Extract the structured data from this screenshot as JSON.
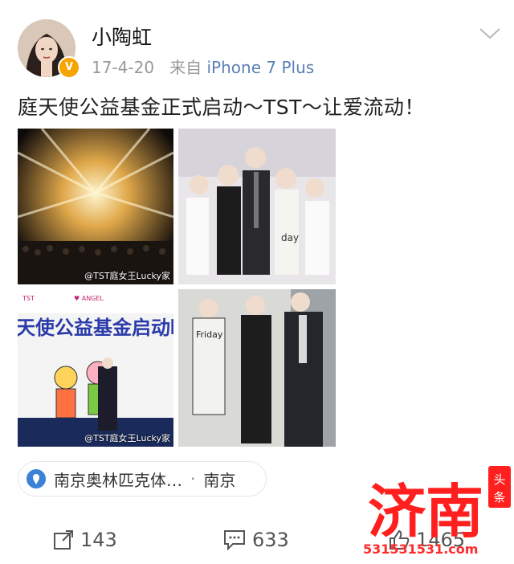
{
  "post": {
    "username": "小陶虹",
    "date": "17-4-20",
    "source_prefix": "来自",
    "source": "iPhone 7 Plus",
    "text": "庭天使公益基金正式启动～TST～让爱流动！",
    "verified_badge": "V"
  },
  "images": [
    {
      "alt": "concert-stage-lights",
      "watermark": ""
    },
    {
      "alt": "stage-group-photo",
      "watermark": ""
    },
    {
      "alt": "charity-gala-banner",
      "watermark": "@TST庭女王Lucky家",
      "banner_text": "天使公益基金启动晚会"
    },
    {
      "alt": "red-carpet-photo",
      "watermark": ""
    }
  ],
  "watermark_tile1": "@TST庭女王Lucky家",
  "location": {
    "name": "南京奥林匹克体…",
    "separator": "·",
    "city": "南京"
  },
  "actions": {
    "repost_count": "143",
    "comment_count": "633",
    "like_count": "1465"
  },
  "overlay": {
    "logo_text": "济南",
    "corner_text": "头条",
    "url": "531531531.com"
  },
  "colors": {
    "source_link": "#5b7fb4",
    "badge": "#f7a400",
    "logo_red": "#ff2a2a"
  }
}
